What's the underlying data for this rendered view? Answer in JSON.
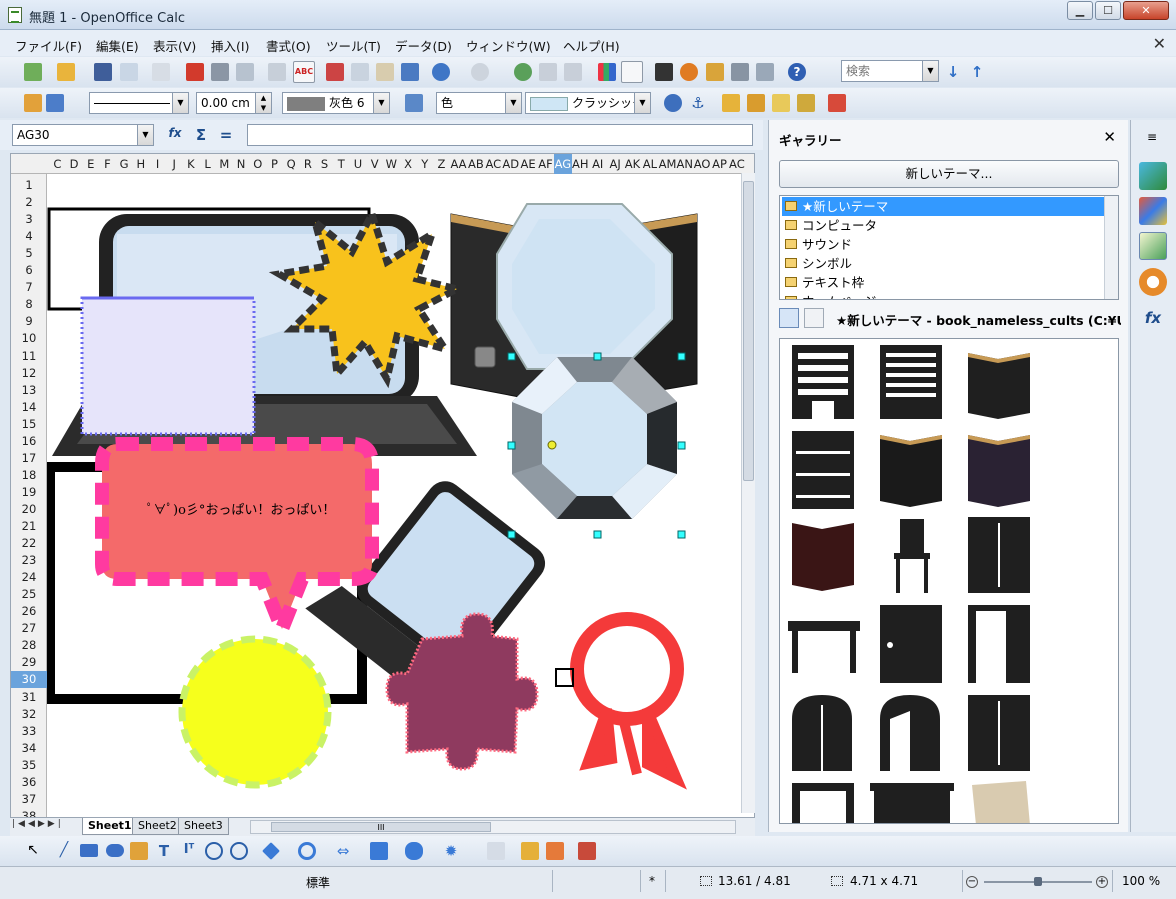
{
  "window": {
    "title": "無題 1 - OpenOffice Calc"
  },
  "menu": [
    "ファイル(F)",
    "編集(E)",
    "表示(V)",
    "挿入(I)",
    "書式(O)",
    "ツール(T)",
    "データ(D)",
    "ウィンドウ(W)",
    "ヘルプ(H)"
  ],
  "toolbar": {
    "search_placeholder": "検索",
    "line_width": "0.00 cm",
    "line_color": "灰色 6",
    "area_style": "色",
    "area_fill": "クラッシック"
  },
  "formula": {
    "name_box": "AG30",
    "content": ""
  },
  "columns": [
    "C",
    "D",
    "E",
    "F",
    "G",
    "H",
    "I",
    "J",
    "K",
    "L",
    "M",
    "N",
    "O",
    "P",
    "Q",
    "R",
    "S",
    "T",
    "U",
    "V",
    "W",
    "X",
    "Y",
    "Z",
    "AA",
    "AB",
    "AC",
    "AD",
    "AE",
    "AF",
    "AG",
    "AH",
    "AI",
    "AJ",
    "AK",
    "AL",
    "AM",
    "AN",
    "AO",
    "AP",
    "AC"
  ],
  "selected_column": "AG",
  "rows": [
    "1",
    "2",
    "3",
    "4",
    "5",
    "6",
    "7",
    "8",
    "9",
    "10",
    "11",
    "12",
    "13",
    "14",
    "15",
    "16",
    "17",
    "18",
    "19",
    "20",
    "21",
    "22",
    "23",
    "24",
    "25",
    "26",
    "27",
    "28",
    "29",
    "30",
    "31",
    "32",
    "33",
    "34",
    "35",
    "36",
    "37",
    "38"
  ],
  "selected_row": "30",
  "callout_text": "ﾟ∀ﾟ)o彡°おっぱい！おっぱい！",
  "sheets": [
    "Sheet1",
    "Sheet2",
    "Sheet3"
  ],
  "scroll_label": "III",
  "gallery": {
    "title": "ギャラリー",
    "new_theme_button": "新しいテーマ...",
    "themes": [
      "★新しいテーマ",
      "コンピュータ",
      "サウンド",
      "シンボル",
      "テキスト枠",
      "ホームページ"
    ],
    "selected_theme": "★新しいテーマ",
    "path_label": "★新しいテーマ - book_nameless_cults (C:¥Us"
  },
  "status": {
    "style": "標準",
    "modified": "*",
    "position": "13.61 / 4.81",
    "size": "4.71 x 4.71",
    "zoom": "100 %"
  },
  "colors": {
    "accent": "#3399ff",
    "selected_header": "#6aa3dc"
  }
}
